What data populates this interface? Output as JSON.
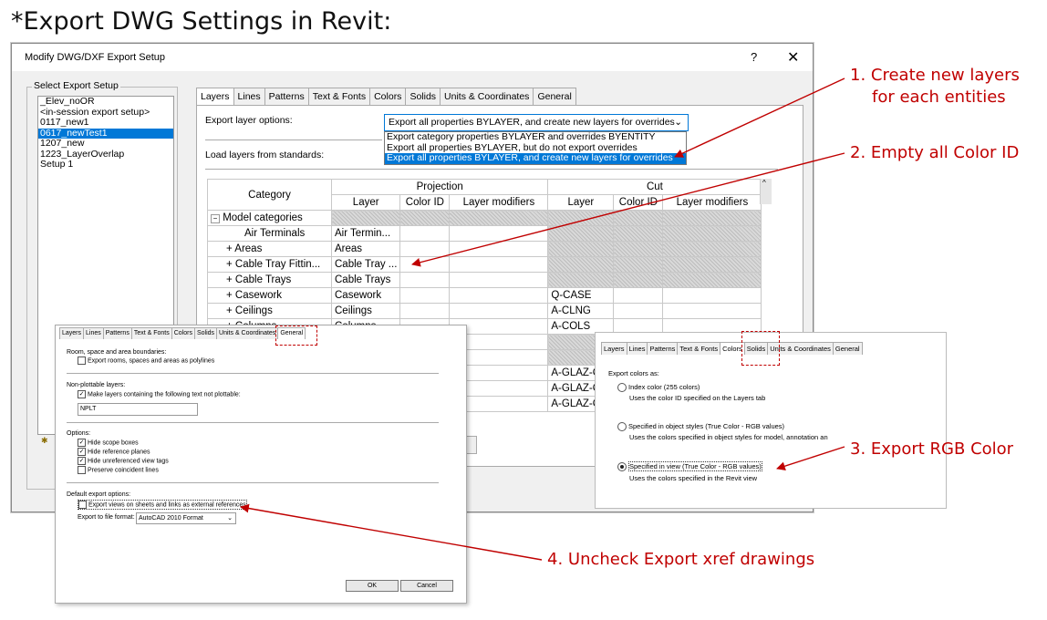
{
  "heading": "*Export DWG Settings in Revit:",
  "dialog": {
    "title": "Modify DWG/DXF Export Setup",
    "help": "?",
    "close": "✕",
    "setup_group_label": "Select Export Setup",
    "setups": [
      "_Elev_noOR",
      "<in-session export setup>",
      "0117_new1",
      "0617_newTest1",
      "1207_new",
      "1223_LayerOverlap",
      "Setup 1"
    ],
    "selected_setup": "0617_newTest1",
    "tabs": [
      "Layers",
      "Lines",
      "Patterns",
      "Text & Fonts",
      "Colors",
      "Solids",
      "Units & Coordinates",
      "General"
    ],
    "active_tab": "Layers",
    "export_layer_label": "Export layer options:",
    "export_layer_value": "Export all properties BYLAYER, and create new layers for overrides",
    "dropdown_options": [
      "Export category properties BYLAYER and overrides BYENTITY",
      "Export all properties BYLAYER, but do not export overrides",
      "Export all properties BYLAYER, and create new layers for overrides"
    ],
    "load_label": "Load layers from standards:",
    "table": {
      "category_header": "Category",
      "projection_header": "Projection",
      "cut_header": "Cut",
      "sub_headers": [
        "Layer",
        "Color ID",
        "Layer modifiers",
        "Layer",
        "Color ID",
        "Layer modifiers"
      ],
      "rows": [
        {
          "cat": "Model categories",
          "proj_layer": "",
          "cut_layer": "",
          "expand": "−"
        },
        {
          "cat": "Air Terminals",
          "proj_layer": "Air Termin...",
          "cut_layer": "",
          "expand": ""
        },
        {
          "cat": "Areas",
          "proj_layer": "Areas",
          "cut_layer": "",
          "expand": "+"
        },
        {
          "cat": "Cable Tray Fittin...",
          "proj_layer": "Cable Tray ...",
          "cut_layer": "",
          "expand": "+"
        },
        {
          "cat": "Cable Trays",
          "proj_layer": "Cable Trays",
          "cut_layer": "",
          "expand": "+"
        },
        {
          "cat": "Casework",
          "proj_layer": "Casework",
          "cut_layer": "Q-CASE",
          "expand": "+"
        },
        {
          "cat": "Ceilings",
          "proj_layer": "Ceilings",
          "cut_layer": "A-CLNG",
          "expand": "+"
        },
        {
          "cat": "Columns",
          "proj_layer": "Columns",
          "cut_layer": "A-COLS",
          "expand": "+"
        }
      ],
      "extra_cut": [
        "A-GLAZ-C",
        "A-GLAZ-C",
        "A-GLAZ-C"
      ]
    }
  },
  "general_panel": {
    "tabs": [
      "Layers",
      "Lines",
      "Patterns",
      "Text & Fonts",
      "Colors",
      "Solids",
      "Units & Coordinates",
      "General"
    ],
    "room_label": "Room, space and area boundaries:",
    "room_check": "Export rooms, spaces and areas as polylines",
    "nonplot_label": "Non-plottable layers:",
    "nonplot_check": "Make layers containing the following text not plottable:",
    "nonplot_value": "NPLT",
    "options_label": "Options:",
    "options": [
      "Hide scope boxes",
      "Hide reference planes",
      "Hide unreferenced view tags",
      "Preserve coincident lines"
    ],
    "default_label": "Default export options:",
    "xref_check": "Export views on sheets and links as external references",
    "format_label": "Export to file format:",
    "format_value": "AutoCAD 2010 Format",
    "ok": "OK",
    "cancel": "Cancel"
  },
  "colors_panel": {
    "tabs": [
      "Layers",
      "Lines",
      "Patterns",
      "Text & Fonts",
      "Colors",
      "Solids",
      "Units & Coordinates",
      "General"
    ],
    "export_as": "Export colors as:",
    "opt1": "Index color (255 colors)",
    "opt1_desc": "Uses the color ID specified on the Layers tab",
    "opt2": "Specified in object styles (True Color - RGB values)",
    "opt2_desc": "Uses the colors specified in object styles for model, annotation an",
    "opt3": "Specified in view (True Color - RGB values)",
    "opt3_desc": "Uses the colors specified in the Revit view"
  },
  "notes": {
    "n1a": "1. Create new layers",
    "n1b": "for each entities",
    "n2": "2. Empty all Color ID",
    "n3": "3. Export RGB Color",
    "n4": "4. Uncheck Export xref drawings"
  },
  "colors": {
    "annotation": "#c00000",
    "selection": "#0078d7"
  }
}
